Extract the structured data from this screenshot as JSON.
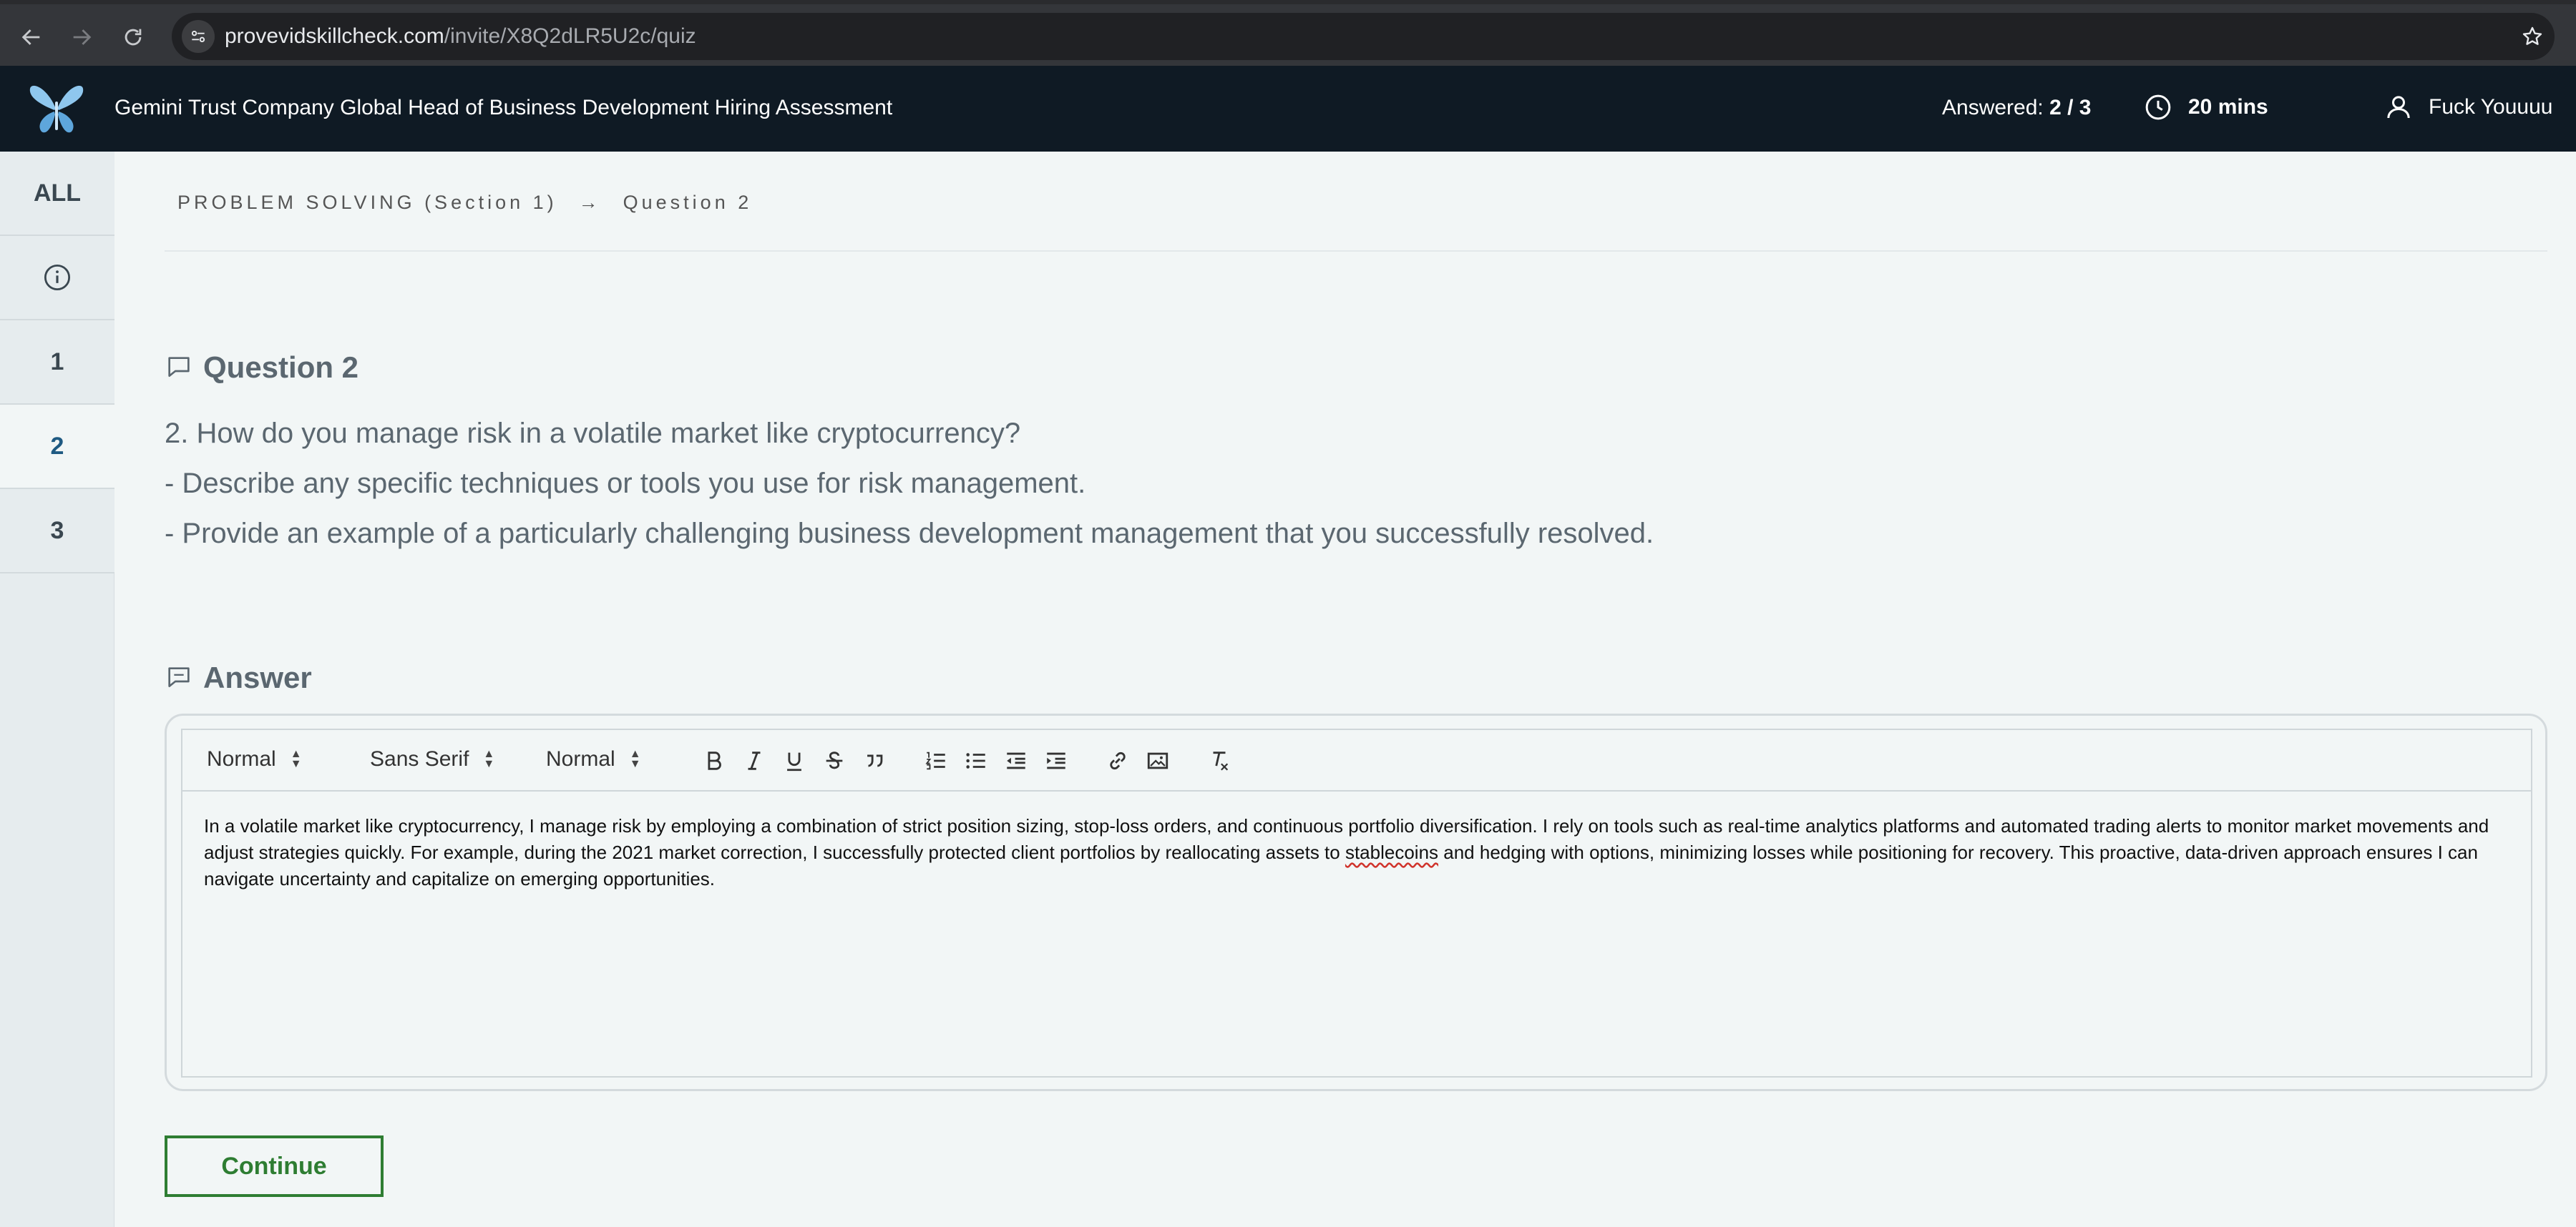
{
  "browser": {
    "url_host": "provevidskillcheck.com",
    "url_path": "/invite/X8Q2dLR5U2c/quiz"
  },
  "header": {
    "title": "Gemini Trust Company Global Head of Business Development Hiring Assessment",
    "answered_label": "Answered:",
    "answered_value": "2 / 3",
    "timer": "20 mins",
    "user_name": "Fuck Youuuu"
  },
  "sidebar": {
    "items": [
      {
        "label": "ALL"
      },
      {
        "label": "info-icon"
      },
      {
        "label": "1"
      },
      {
        "label": "2"
      },
      {
        "label": "3"
      }
    ]
  },
  "breadcrumb": {
    "section": "PROBLEM SOLVING (Section 1)",
    "arrow": "→",
    "question": "Question 2"
  },
  "question": {
    "heading": "Question 2",
    "lines": [
      "2. How do you manage risk in a volatile market like cryptocurrency?",
      "- Describe any specific techniques or tools you use for risk management.",
      "- Provide an example of a particularly challenging business development management that you successfully resolved."
    ]
  },
  "answer": {
    "heading": "Answer",
    "toolbar": {
      "heading_select": "Normal",
      "font_select": "Sans Serif",
      "size_select": "Normal"
    },
    "text_part1": "In a volatile market like cryptocurrency, I manage risk by employing a combination of strict position sizing, stop-loss orders, and continuous portfolio diversification. I rely on tools such as real-time analytics platforms and automated trading alerts to monitor market movements and adjust strategies quickly. For example, during the 2021 market correction, I successfully protected client portfolios by reallocating assets to ",
    "text_flagged": "stablecoins",
    "text_part2": " and hedging with options, minimizing losses while positioning for recovery. This proactive, data-driven approach ensures I can navigate uncertainty and capitalize on emerging opportunities."
  },
  "actions": {
    "continue_label": "Continue"
  },
  "colors": {
    "header_bg": "#0f1a24",
    "active_nav": "#1f5a82",
    "continue_green": "#2e7d32"
  }
}
